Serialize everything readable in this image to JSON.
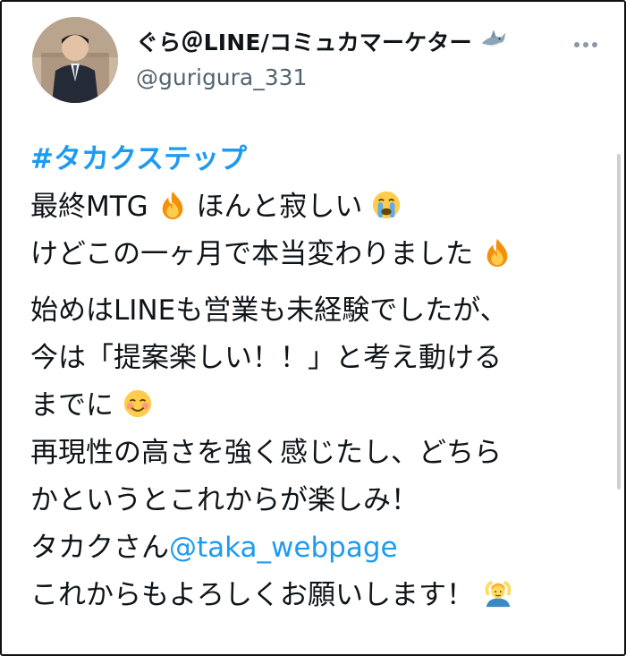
{
  "tweet": {
    "author_name": "ぐら＠LINE/コミュカマーケター",
    "shark_emoji_icon": "shark-emoji-icon",
    "handle": "@gurigura_331",
    "more_icon": "more-options-icon",
    "hashtag": "#タカクステップ",
    "lines": {
      "l1": "最終MTG",
      "l1b": "ほんと寂しい",
      "l2": "けどこの一ヶ月で本当変わりました",
      "l3": "始めはLINEも営業も未経験でしたが、",
      "l4": "今は「提案楽しい！！」と考え動ける",
      "l5": "までに",
      "l6": "再現性の高さを強く感じたし、どちら",
      "l7": "かというとこれからが楽しみ！",
      "l8": "タカクさん",
      "mention": "@taka_webpage",
      "l9": "これからもよろしくお願いします！"
    }
  }
}
